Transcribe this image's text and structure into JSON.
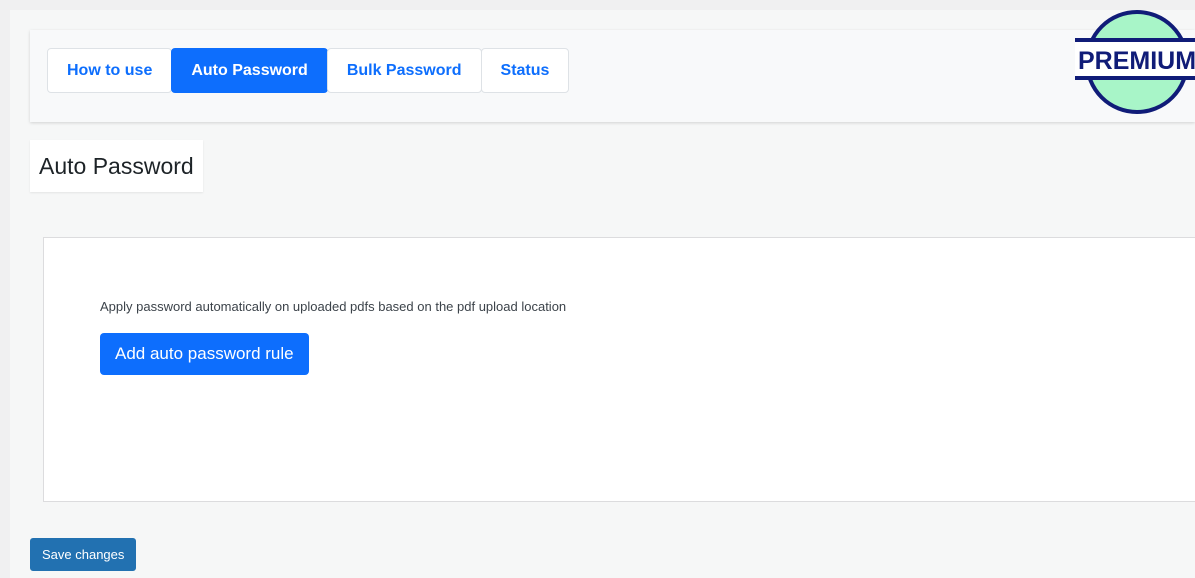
{
  "tabs": [
    {
      "label": "How to use",
      "active": false
    },
    {
      "label": "Auto Password",
      "active": true
    },
    {
      "label": "Bulk Password",
      "active": false
    },
    {
      "label": "Status",
      "active": false
    }
  ],
  "badge": {
    "text": "PREMIUM",
    "ring_color": "#101c78",
    "fill_color": "#a8f5c8"
  },
  "page": {
    "title": "Auto Password"
  },
  "card": {
    "description": "Apply password automatically on uploaded pdfs based on the pdf upload location",
    "button_label": "Add auto password rule"
  },
  "footer": {
    "save_label": "Save changes"
  },
  "colors": {
    "accent": "#0d6efd",
    "save": "#2271b1"
  }
}
